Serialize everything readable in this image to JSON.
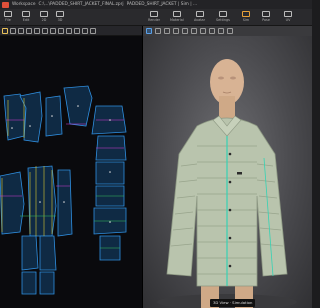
{
  "titlebar": {
    "app_name": "Workspace",
    "file_path": "C:\\...\\PADDED_SHIRT_JACKET_FINAL.zprj",
    "tabs_text": "PADDED_SHIRT_JACKET | Sim | ..."
  },
  "menubar": {
    "items": [
      "File",
      "Edit",
      "2D",
      "3D",
      "Render",
      "Material",
      "Avatar",
      "Settings",
      "Sim",
      "Pose",
      "UV"
    ]
  },
  "toolbar_2d": {
    "icons": [
      "select-icon",
      "transform-icon",
      "segment-icon",
      "polygon-icon",
      "rectangle-icon",
      "circle-icon",
      "dart-icon",
      "trace-icon",
      "seam-icon",
      "pin-icon",
      "text-icon",
      "zoom-icon"
    ]
  },
  "toolbar_3d": {
    "icons": [
      "simulate-icon",
      "select-mesh-icon",
      "move-icon",
      "pin-icon",
      "measure-icon",
      "fold-icon",
      "strengthen-icon",
      "avatar-icon",
      "camera-icon",
      "light-icon"
    ]
  },
  "viewport_3d": {
    "status_label": "3D View · Simulation"
  },
  "colors": {
    "pattern_blue": "#2f8fe0",
    "seam_yellow": "#d9c931",
    "seam_magenta": "#d63ad6",
    "seam_green": "#39c45a",
    "jacket": "#b9c4ad",
    "avatar_skin": "#d8b394",
    "seam_teal": "#36d2b4"
  }
}
